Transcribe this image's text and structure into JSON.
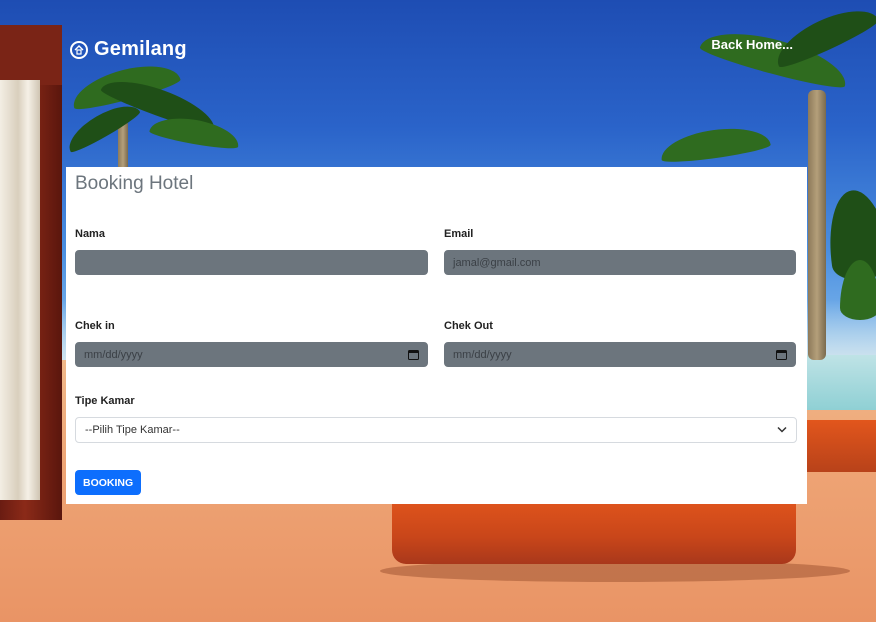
{
  "brand": {
    "name": "Gemilang",
    "logo_icon": "building-icon"
  },
  "nav": {
    "back_home": "Back Home..."
  },
  "form": {
    "title": "Booking Hotel",
    "nama": {
      "label": "Nama",
      "value": ""
    },
    "email": {
      "label": "Email",
      "placeholder": "jamal@gmail.com"
    },
    "checkin": {
      "label": "Chek in",
      "placeholder": "mm/dd/yyyy"
    },
    "checkout": {
      "label": "Chek Out",
      "placeholder": "mm/dd/yyyy"
    },
    "tipe_kamar": {
      "label": "Tipe Kamar",
      "selected": "--Pilih Tipe Kamar--"
    },
    "submit_label": "BOOKING"
  },
  "colors": {
    "primary": "#0d6efd",
    "input_bg": "#6c757d",
    "title": "#6c757d"
  }
}
